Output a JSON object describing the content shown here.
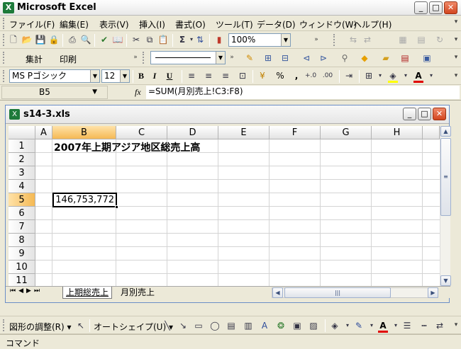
{
  "app": {
    "title": "Microsoft Excel",
    "icon_label": "X"
  },
  "window_buttons": {
    "minimize": "_",
    "restore": "□",
    "close": "✕"
  },
  "menu": [
    "ファイル(F)",
    "編集(E)",
    "表示(V)",
    "挿入(I)",
    "書式(O)",
    "ツール(T)",
    "データ(D)",
    "ウィンドウ(W)",
    "ヘルプ(H)"
  ],
  "standard_toolbar": {
    "zoom": "100%"
  },
  "custom_toolbar": {
    "button1": "集計",
    "button2": "印刷"
  },
  "format_toolbar": {
    "font": "MS Pゴシック",
    "size": "12",
    "bold": "B",
    "italic": "I",
    "underline": "U",
    "percent": "%",
    "comma": ","
  },
  "formula_bar": {
    "name_box": "B5",
    "fx": "fx",
    "formula": "=SUM(月別売上!C3:F8)"
  },
  "workbook": {
    "title": "s14-3.xls",
    "columns": [
      "A",
      "B",
      "C",
      "D",
      "E",
      "F",
      "G",
      "H"
    ],
    "rows": [
      "1",
      "2",
      "3",
      "4",
      "5",
      "6",
      "7",
      "8",
      "9",
      "10",
      "11"
    ],
    "selected_cell": "B5",
    "cells": {
      "B1": "2007年上期アジア地区総売上高",
      "B5": "146,753,772"
    },
    "sheets": [
      "上期総売上",
      "月別売上"
    ],
    "active_sheet": "上期総売上"
  },
  "drawing_toolbar": {
    "adjust": "図形の調整(R) ▾",
    "autoshape": "オートシェイプ(U) ▾"
  },
  "status": {
    "text": "コマンド"
  },
  "colors": {
    "selection_header": "#f5b954",
    "font_color": "#e00000",
    "fill_color": "#ffff00"
  }
}
